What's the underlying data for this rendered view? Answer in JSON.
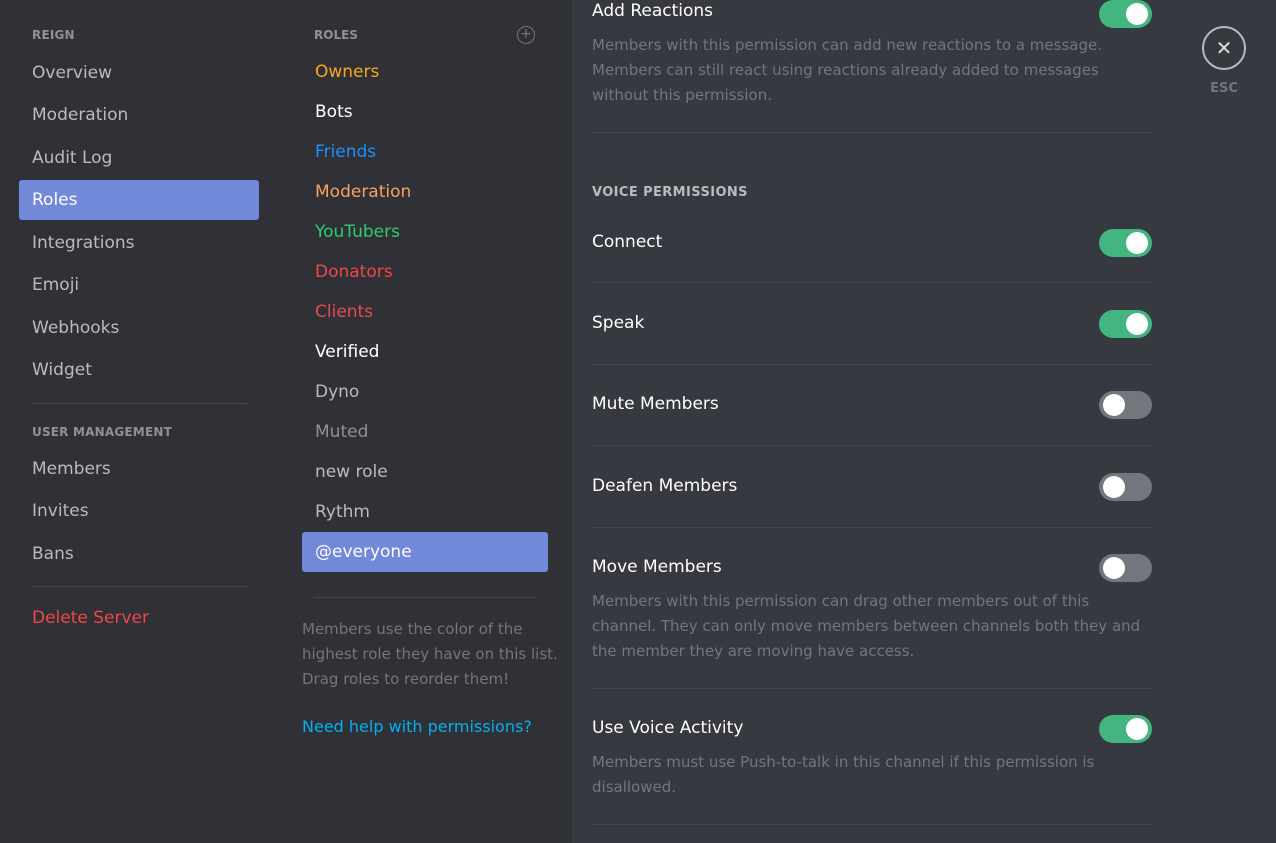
{
  "sidebar": {
    "server_header": "REIGN",
    "items": [
      "Overview",
      "Moderation",
      "Audit Log",
      "Roles",
      "Integrations",
      "Emoji",
      "Webhooks",
      "Widget"
    ],
    "user_mgmt_header": "USER MANAGEMENT",
    "user_items": [
      "Members",
      "Invites",
      "Bans"
    ],
    "delete_label": "Delete Server"
  },
  "roles": {
    "header": "ROLES",
    "add_icon": "plus-circle-icon",
    "items": [
      {
        "label": "Owners",
        "color": "#faa61a"
      },
      {
        "label": "Bots",
        "color": "#ffffff"
      },
      {
        "label": "Friends",
        "color": "#1f8fff"
      },
      {
        "label": "Moderation",
        "color": "#f9a15e"
      },
      {
        "label": "YouTubers",
        "color": "#2ecc71"
      },
      {
        "label": "Donators",
        "color": "#f04747"
      },
      {
        "label": "Clients",
        "color": "#e84b4b"
      },
      {
        "label": "Verified",
        "color": "#ffffff"
      },
      {
        "label": "Dyno",
        "color": "#b9bbbe"
      },
      {
        "label": "Muted",
        "color": "#8e9297"
      },
      {
        "label": "new role",
        "color": "#b9bbbe"
      },
      {
        "label": "Rythm",
        "color": "#b9bbbe"
      },
      {
        "label": "@everyone",
        "color": "#ffffff"
      }
    ],
    "hint": "Members use the color of the highest role they have on this list. Drag roles to reorder them!",
    "help_link": "Need help with permissions?"
  },
  "permissions": {
    "add_reactions": {
      "title": "Add Reactions",
      "desc": "Members with this permission can add new reactions to a message. Members can still react using reactions already added to messages without this permission.",
      "enabled": true
    },
    "voice_header": "VOICE PERMISSIONS",
    "voice": [
      {
        "title": "Connect",
        "enabled": true
      },
      {
        "title": "Speak",
        "enabled": true
      },
      {
        "title": "Mute Members",
        "enabled": false
      },
      {
        "title": "Deafen Members",
        "enabled": false
      },
      {
        "title": "Move Members",
        "enabled": false,
        "desc": "Members with this permission can drag other members out of this channel. They can only move members between channels both they and the member they are moving have access."
      },
      {
        "title": "Use Voice Activity",
        "enabled": true,
        "desc": "Members must use Push-to-talk in this channel if this permission is disallowed."
      }
    ]
  },
  "close": {
    "icon": "close-icon",
    "label": "ESC"
  },
  "colors": {
    "accent": "#7289da",
    "toggle_on": "#43b581",
    "toggle_off": "#72767d",
    "danger": "#f04747",
    "link": "#00b0f4"
  }
}
